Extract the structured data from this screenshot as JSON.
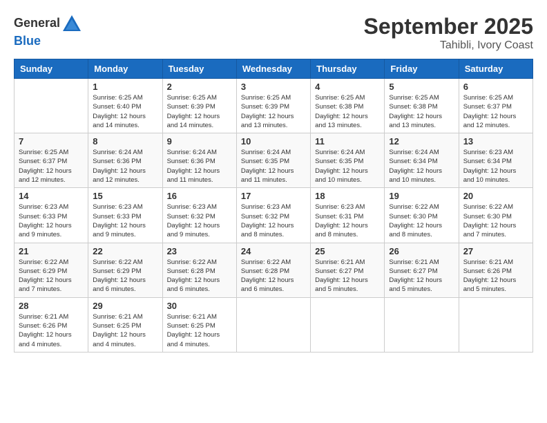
{
  "logo": {
    "general": "General",
    "blue": "Blue"
  },
  "title": "September 2025",
  "location": "Tahibli, Ivory Coast",
  "headers": [
    "Sunday",
    "Monday",
    "Tuesday",
    "Wednesday",
    "Thursday",
    "Friday",
    "Saturday"
  ],
  "weeks": [
    [
      {
        "day": "",
        "info": ""
      },
      {
        "day": "1",
        "info": "Sunrise: 6:25 AM\nSunset: 6:40 PM\nDaylight: 12 hours\nand 14 minutes."
      },
      {
        "day": "2",
        "info": "Sunrise: 6:25 AM\nSunset: 6:39 PM\nDaylight: 12 hours\nand 14 minutes."
      },
      {
        "day": "3",
        "info": "Sunrise: 6:25 AM\nSunset: 6:39 PM\nDaylight: 12 hours\nand 13 minutes."
      },
      {
        "day": "4",
        "info": "Sunrise: 6:25 AM\nSunset: 6:38 PM\nDaylight: 12 hours\nand 13 minutes."
      },
      {
        "day": "5",
        "info": "Sunrise: 6:25 AM\nSunset: 6:38 PM\nDaylight: 12 hours\nand 13 minutes."
      },
      {
        "day": "6",
        "info": "Sunrise: 6:25 AM\nSunset: 6:37 PM\nDaylight: 12 hours\nand 12 minutes."
      }
    ],
    [
      {
        "day": "7",
        "info": "Sunrise: 6:25 AM\nSunset: 6:37 PM\nDaylight: 12 hours\nand 12 minutes."
      },
      {
        "day": "8",
        "info": "Sunrise: 6:24 AM\nSunset: 6:36 PM\nDaylight: 12 hours\nand 12 minutes."
      },
      {
        "day": "9",
        "info": "Sunrise: 6:24 AM\nSunset: 6:36 PM\nDaylight: 12 hours\nand 11 minutes."
      },
      {
        "day": "10",
        "info": "Sunrise: 6:24 AM\nSunset: 6:35 PM\nDaylight: 12 hours\nand 11 minutes."
      },
      {
        "day": "11",
        "info": "Sunrise: 6:24 AM\nSunset: 6:35 PM\nDaylight: 12 hours\nand 10 minutes."
      },
      {
        "day": "12",
        "info": "Sunrise: 6:24 AM\nSunset: 6:34 PM\nDaylight: 12 hours\nand 10 minutes."
      },
      {
        "day": "13",
        "info": "Sunrise: 6:23 AM\nSunset: 6:34 PM\nDaylight: 12 hours\nand 10 minutes."
      }
    ],
    [
      {
        "day": "14",
        "info": "Sunrise: 6:23 AM\nSunset: 6:33 PM\nDaylight: 12 hours\nand 9 minutes."
      },
      {
        "day": "15",
        "info": "Sunrise: 6:23 AM\nSunset: 6:33 PM\nDaylight: 12 hours\nand 9 minutes."
      },
      {
        "day": "16",
        "info": "Sunrise: 6:23 AM\nSunset: 6:32 PM\nDaylight: 12 hours\nand 9 minutes."
      },
      {
        "day": "17",
        "info": "Sunrise: 6:23 AM\nSunset: 6:32 PM\nDaylight: 12 hours\nand 8 minutes."
      },
      {
        "day": "18",
        "info": "Sunrise: 6:23 AM\nSunset: 6:31 PM\nDaylight: 12 hours\nand 8 minutes."
      },
      {
        "day": "19",
        "info": "Sunrise: 6:22 AM\nSunset: 6:30 PM\nDaylight: 12 hours\nand 8 minutes."
      },
      {
        "day": "20",
        "info": "Sunrise: 6:22 AM\nSunset: 6:30 PM\nDaylight: 12 hours\nand 7 minutes."
      }
    ],
    [
      {
        "day": "21",
        "info": "Sunrise: 6:22 AM\nSunset: 6:29 PM\nDaylight: 12 hours\nand 7 minutes."
      },
      {
        "day": "22",
        "info": "Sunrise: 6:22 AM\nSunset: 6:29 PM\nDaylight: 12 hours\nand 6 minutes."
      },
      {
        "day": "23",
        "info": "Sunrise: 6:22 AM\nSunset: 6:28 PM\nDaylight: 12 hours\nand 6 minutes."
      },
      {
        "day": "24",
        "info": "Sunrise: 6:22 AM\nSunset: 6:28 PM\nDaylight: 12 hours\nand 6 minutes."
      },
      {
        "day": "25",
        "info": "Sunrise: 6:21 AM\nSunset: 6:27 PM\nDaylight: 12 hours\nand 5 minutes."
      },
      {
        "day": "26",
        "info": "Sunrise: 6:21 AM\nSunset: 6:27 PM\nDaylight: 12 hours\nand 5 minutes."
      },
      {
        "day": "27",
        "info": "Sunrise: 6:21 AM\nSunset: 6:26 PM\nDaylight: 12 hours\nand 5 minutes."
      }
    ],
    [
      {
        "day": "28",
        "info": "Sunrise: 6:21 AM\nSunset: 6:26 PM\nDaylight: 12 hours\nand 4 minutes."
      },
      {
        "day": "29",
        "info": "Sunrise: 6:21 AM\nSunset: 6:25 PM\nDaylight: 12 hours\nand 4 minutes."
      },
      {
        "day": "30",
        "info": "Sunrise: 6:21 AM\nSunset: 6:25 PM\nDaylight: 12 hours\nand 4 minutes."
      },
      {
        "day": "",
        "info": ""
      },
      {
        "day": "",
        "info": ""
      },
      {
        "day": "",
        "info": ""
      },
      {
        "day": "",
        "info": ""
      }
    ]
  ]
}
